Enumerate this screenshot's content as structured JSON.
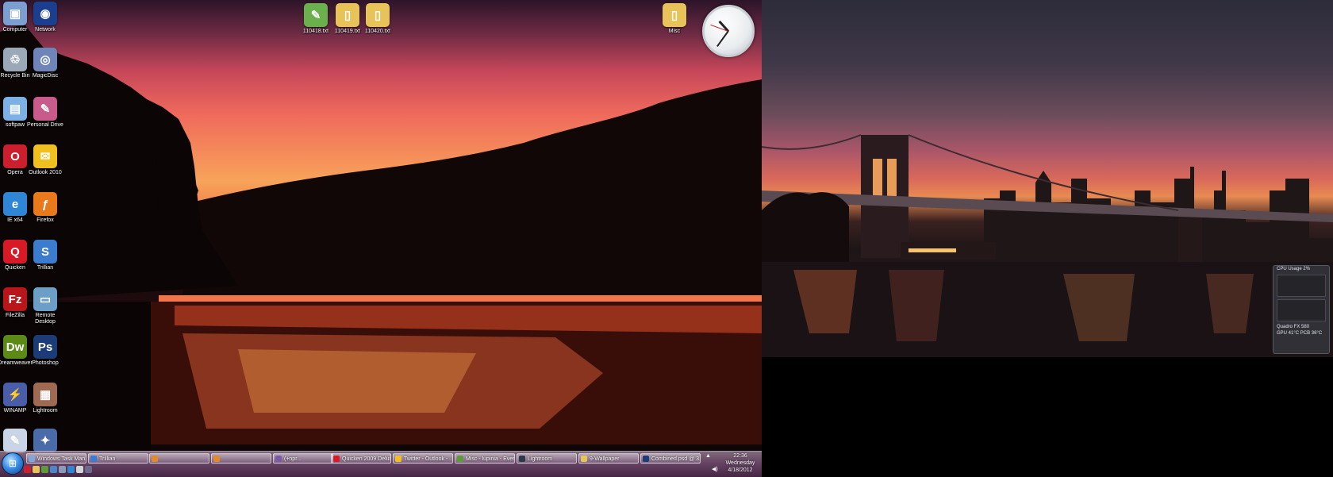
{
  "desktop_icons": [
    {
      "key": "computer",
      "label": "Computer",
      "color": "#7a9fd0",
      "glyph": "▣"
    },
    {
      "key": "network",
      "label": "Network",
      "color": "#1b3e8f",
      "glyph": "◉"
    },
    {
      "key": "recycle",
      "label": "Recycle Bin",
      "color": "#9aa8b8",
      "glyph": "♲"
    },
    {
      "key": "magicdisc",
      "label": "MagicDisc",
      "color": "#6f84b8",
      "glyph": "◎"
    },
    {
      "key": "softpaw",
      "label": "softpaw",
      "color": "#7eb0e8",
      "glyph": "▤"
    },
    {
      "key": "personaldrive",
      "label": "Personal Drive",
      "color": "#c85a8c",
      "glyph": "✎"
    },
    {
      "key": "opera",
      "label": "Opera",
      "color": "#cc1f2e",
      "glyph": "O"
    },
    {
      "key": "outlook",
      "label": "Outlook 2010",
      "color": "#f0c020",
      "glyph": "✉"
    },
    {
      "key": "iex64",
      "label": "IE x64",
      "color": "#2e86d4",
      "glyph": "e"
    },
    {
      "key": "firefox",
      "label": "Firefox",
      "color": "#e87a1c",
      "glyph": "ƒ"
    },
    {
      "key": "quicken",
      "label": "Quicken",
      "color": "#d71a26",
      "glyph": "Q"
    },
    {
      "key": "trillian",
      "label": "Trillian",
      "color": "#3c7ccf",
      "glyph": "S"
    },
    {
      "key": "filezilla",
      "label": "FileZilla",
      "color": "#b8161a",
      "glyph": "Fz"
    },
    {
      "key": "remotedesktop",
      "label": "Remote Desktop",
      "color": "#6c9fc8",
      "glyph": "▭"
    },
    {
      "key": "dreamweaver",
      "label": "Dreamweaver",
      "color": "#5c8a16",
      "glyph": "Dw"
    },
    {
      "key": "photoshop",
      "label": "Photoshop",
      "color": "#1c3c78",
      "glyph": "Ps"
    },
    {
      "key": "winamp",
      "label": "WINAMP",
      "color": "#4a5da8",
      "glyph": "⚡"
    },
    {
      "key": "lightroom",
      "label": "Lightroom",
      "color": "#a06a52",
      "glyph": "▦"
    },
    {
      "key": "extra1",
      "label": "",
      "color": "#c9d4e6",
      "glyph": "✎"
    },
    {
      "key": "extra2",
      "label": "",
      "color": "#4a6aa8",
      "glyph": "✦"
    }
  ],
  "top_icons": [
    {
      "key": "top1",
      "label": "110418.txt",
      "color": "#6ab04c",
      "glyph": "✎"
    },
    {
      "key": "top2",
      "label": "110419.txt",
      "color": "#e8c35a",
      "glyph": "▯"
    },
    {
      "key": "top3",
      "label": "110420.txt",
      "color": "#e8c35a",
      "glyph": "▯"
    },
    {
      "key": "misc",
      "label": "Misc",
      "color": "#e8c35a",
      "glyph": "▯"
    }
  ],
  "clock": {
    "hour": 10,
    "minute": 36
  },
  "gadget": {
    "cpu_title": "CPU Usage",
    "cpu_value": "2%",
    "gpu_title": "Quadro FX 580",
    "gpu_temp": "GPU  41°C  PCB  36°C"
  },
  "taskbar": {
    "start_label": "Start",
    "buttons": [
      {
        "label": "Windows Task Man...",
        "color": "#7ea8d8"
      },
      {
        "label": "Trillian",
        "color": "#3c7ccf"
      },
      {
        "label": "",
        "color": "#e08a2a"
      },
      {
        "label": "",
        "color": "#e08a2a"
      },
      {
        "label": "(+npr...",
        "color": "#7a5aa8"
      },
      {
        "label": "Quicken 2009 Delux...",
        "color": "#d71a26"
      },
      {
        "label": "Twitter - Outlook - ...",
        "color": "#f0c020"
      },
      {
        "label": "Misc - lupinia - Ever...",
        "color": "#5c9a3c"
      },
      {
        "label": "Lightroom",
        "color": "#2a3a4a"
      },
      {
        "label": "9-Wallpaper",
        "color": "#e8c35a"
      },
      {
        "label": "Combined.psd @ 3...",
        "color": "#1c3c78"
      }
    ],
    "quick_launch": [
      "#cc1f2e",
      "#e8c35a",
      "#5c9a3c",
      "#4a86c8",
      "#8a9ab8",
      "#2e86d4",
      "#d4d4d4",
      "#6a6a8a"
    ],
    "time": "22:36",
    "day": "Wednesday",
    "date": "4/18/2012"
  }
}
